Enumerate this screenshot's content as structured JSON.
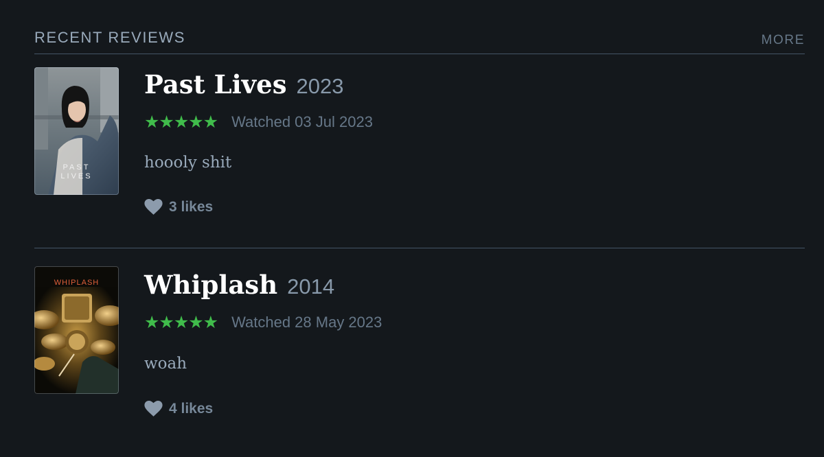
{
  "section": {
    "title": "RECENT REVIEWS",
    "more_label": "MORE"
  },
  "reviews": [
    {
      "title": "Past Lives",
      "year": "2023",
      "rating_stars": "★★★★★",
      "rating": 5,
      "watched": "Watched 03 Jul 2023",
      "text": "hoooly shit",
      "likes": "3 likes",
      "poster": {
        "caption_line1": "PAST",
        "caption_line2": "LIVES"
      }
    },
    {
      "title": "Whiplash",
      "year": "2014",
      "rating_stars": "★★★★★",
      "rating": 5,
      "watched": "Watched 28 May 2023",
      "text": "woah",
      "likes": "4 likes",
      "poster": {
        "caption": "WHIPLASH"
      }
    }
  ],
  "colors": {
    "background": "#14181c",
    "star_green": "#40bc4b",
    "divider": "#445566",
    "muted_text": "#99aabb"
  },
  "icons": {
    "like": "heart-icon",
    "rating": "star-icon"
  }
}
